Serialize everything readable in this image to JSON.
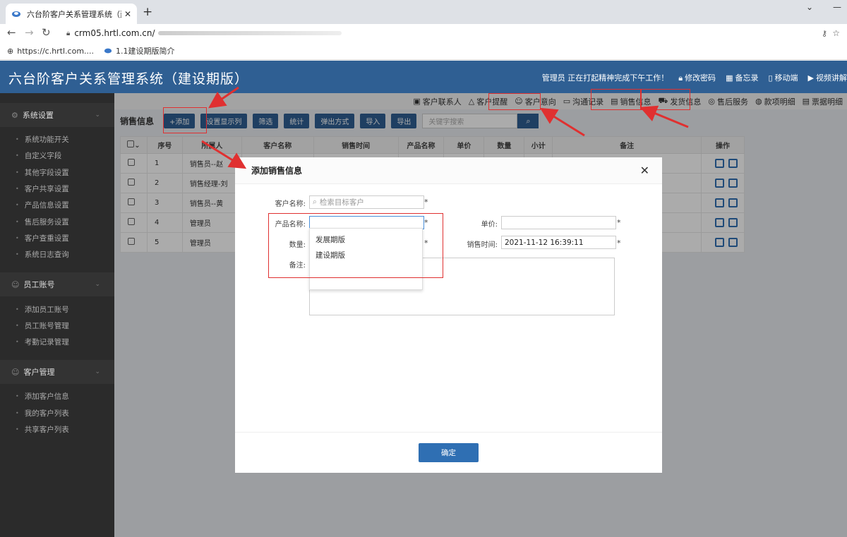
{
  "browser": {
    "tab_title": "六台阶客户关系管理系统（建设期",
    "url": "crm05.hrtl.com.cn/",
    "bookmarks": [
      "https://c.hrtl.com....",
      "1.1建设期版简介"
    ]
  },
  "app": {
    "title": "六台阶客户关系管理系统（建设期版）",
    "header_links": [
      "管理员 正在打起精神完成下午工作！",
      "修改密码",
      "备忘录",
      "移动端",
      "视频讲解"
    ]
  },
  "sidebar": {
    "groups": [
      {
        "label": "系统设置",
        "items": [
          "系统功能开关",
          "自定义字段",
          "其他字段设置",
          "客户共享设置",
          "产品信息设置",
          "售后服务设置",
          "客户查重设置",
          "系统日志查询"
        ]
      },
      {
        "label": "员工账号",
        "items": [
          "添加员工账号",
          "员工账号管理",
          "考勤记录管理"
        ]
      },
      {
        "label": "客户管理",
        "items": [
          "添加客户信息",
          "我的客户列表",
          "共享客户列表"
        ]
      }
    ]
  },
  "topnav": [
    "客户联系人",
    "客户提醒",
    "客户意向",
    "沟通记录",
    "销售信息",
    "发货信息",
    "售后服务",
    "款项明细",
    "票据明细"
  ],
  "toolbar": {
    "page_title": "销售信息",
    "buttons": [
      "+添加",
      "设置显示列",
      "筛选",
      "统计",
      "弹出方式",
      "导入",
      "导出"
    ],
    "search_placeholder": "关键字搜索"
  },
  "table": {
    "headers": [
      "序号",
      "所属人",
      "客户名称",
      "销售时间",
      "产品名称",
      "单价",
      "数量",
      "小计",
      "备注",
      "操作"
    ],
    "rows": [
      {
        "no": "1",
        "owner": "销售员--赵"
      },
      {
        "no": "2",
        "owner": "销售经理-刘"
      },
      {
        "no": "3",
        "owner": "销售员--黄"
      },
      {
        "no": "4",
        "owner": "管理员"
      },
      {
        "no": "5",
        "owner": "管理员"
      }
    ]
  },
  "modal": {
    "title": "添加销售信息",
    "close": "✕",
    "customer_label": "客户名称:",
    "customer_placeholder": "检索目标客户",
    "product_label": "产品名称:",
    "price_label": "单价:",
    "qty_label": "数量:",
    "time_label": "销售时间:",
    "time_value": "2021-11-12 16:39:11",
    "note_label": "备注:",
    "required": "*",
    "dropdown_options": [
      "发展期版",
      "建设期版"
    ],
    "ok": "确定"
  },
  "colors": {
    "header": "#2f5f93",
    "accent": "#2f6fb3",
    "highlight": "#e03030"
  }
}
